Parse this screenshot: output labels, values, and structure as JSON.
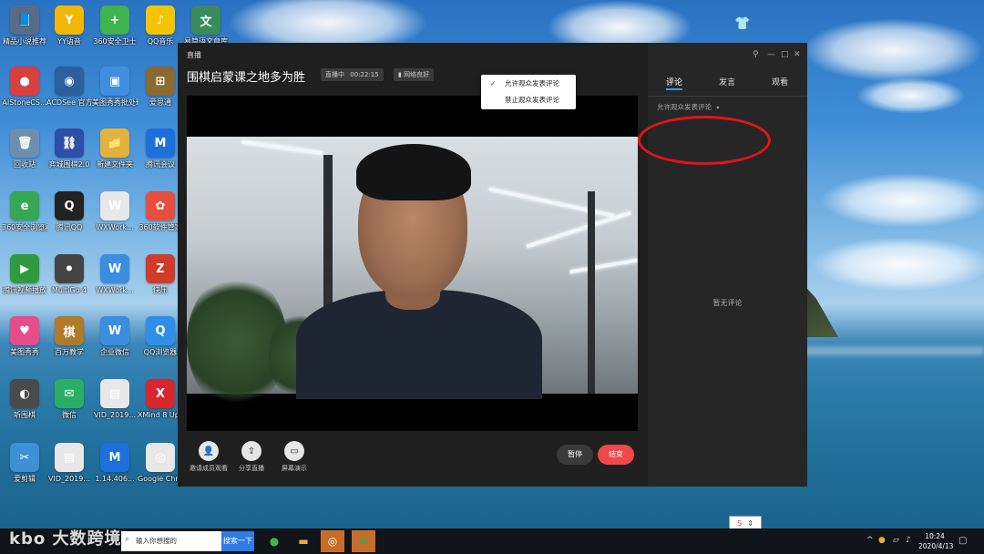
{
  "desktop": {
    "icons": [
      {
        "label": "精品小说推荐",
        "glyph": "📘",
        "color": "#5a6b8a"
      },
      {
        "label": "YY语音",
        "glyph": "Y",
        "color": "#f2b705"
      },
      {
        "label": "360安全卫士",
        "glyph": "+",
        "color": "#3fb34f"
      },
      {
        "label": "QQ音乐",
        "glyph": "♪",
        "color": "#f5c400"
      },
      {
        "label": "易简语文章库",
        "glyph": "文",
        "color": "#3a8b5c"
      },
      {
        "label": "AIStoneCS...",
        "glyph": "●",
        "color": "#d84040"
      },
      {
        "label": "ACDSee 官方免费版",
        "glyph": "◉",
        "color": "#2b5f9e"
      },
      {
        "label": "美图秀秀批处理",
        "glyph": "▣",
        "color": "#3f8ee0"
      },
      {
        "label": "爱思通",
        "glyph": "⊞",
        "color": "#8a6a30"
      },
      {
        "label": "回收站",
        "glyph": "🗑",
        "color": "#6c8fb0"
      },
      {
        "label": "弈城围棋2.0",
        "glyph": "⛓",
        "color": "#2d4fa8"
      },
      {
        "label": "新建文件夹",
        "glyph": "📁",
        "color": "#e3b23c"
      },
      {
        "label": "腾讯会议",
        "glyph": "M",
        "color": "#1e6fdc"
      },
      {
        "label": "360安全浏览器",
        "glyph": "e",
        "color": "#34a853"
      },
      {
        "label": "腾讯QQ",
        "glyph": "Q",
        "color": "#222222"
      },
      {
        "label": "WXWork...",
        "glyph": "W",
        "color": "#e8e8e8"
      },
      {
        "label": "360软件管家",
        "glyph": "✿",
        "color": "#e94e3c"
      },
      {
        "label": "腾讯视频播放",
        "glyph": "▶",
        "color": "#2f9a3f"
      },
      {
        "label": "MultiGo 4",
        "glyph": "⚫",
        "color": "#444444"
      },
      {
        "label": "WXWork...",
        "glyph": "W",
        "color": "#3b8de0"
      },
      {
        "label": "快压",
        "glyph": "Z",
        "color": "#d03b2a"
      },
      {
        "label": "美图秀秀",
        "glyph": "♥",
        "color": "#e84c88"
      },
      {
        "label": "百万教学",
        "glyph": "棋",
        "color": "#b07a2a"
      },
      {
        "label": "企业微信",
        "glyph": "W",
        "color": "#3b8de0"
      },
      {
        "label": "QQ浏览器",
        "glyph": "Q",
        "color": "#2f8fe6"
      },
      {
        "label": "听围棋",
        "glyph": "◐",
        "color": "#4a4a4a"
      },
      {
        "label": "微信",
        "glyph": "✉",
        "color": "#2aae67"
      },
      {
        "label": "VID_2019...",
        "glyph": "▤",
        "color": "#e8e8e8"
      },
      {
        "label": "XMind 8 Update 7",
        "glyph": "X",
        "color": "#d7262e"
      },
      {
        "label": "爱剪辑",
        "glyph": "✂",
        "color": "#3e8fd4"
      },
      {
        "label": "VID_2019...",
        "glyph": "▤",
        "color": "#e8e8e8"
      },
      {
        "label": "1.14.406...",
        "glyph": "M",
        "color": "#1e6fdc"
      },
      {
        "label": "Google Chrome",
        "glyph": "◎",
        "color": "#e8e8e8"
      }
    ]
  },
  "live_window": {
    "title": "直播",
    "course_title": "围棋启蒙课之地多为胜",
    "status_live": "直播中",
    "duration": "00:22:15",
    "network": "网络良好",
    "bottom_buttons": [
      {
        "label": "邀请成员观看",
        "icon": "invite-icon",
        "glyph": "👤"
      },
      {
        "label": "分享直播",
        "icon": "share-icon",
        "glyph": "⇪"
      },
      {
        "label": "屏幕演示",
        "icon": "screen-share-icon",
        "glyph": "▭"
      }
    ],
    "pause_label": "暂停",
    "end_label": "结束",
    "accent": "#f0474a"
  },
  "side_panel": {
    "tabs": [
      "评论",
      "发言",
      "观看"
    ],
    "active_tab": 0,
    "filter_label": "允许观众发表评论",
    "dropdown_options": [
      {
        "label": "允许观众发表评论",
        "checked": true
      },
      {
        "label": "禁止观众发表评论",
        "checked": false
      }
    ],
    "empty_text": "暂无评论"
  },
  "taskbar": {
    "search_placeholder": "输入你想搜的",
    "search_button": "搜索一下",
    "time": "10:24",
    "date": "2020/4/13",
    "watermark": "kbo 大数跨境",
    "ime": "S"
  }
}
